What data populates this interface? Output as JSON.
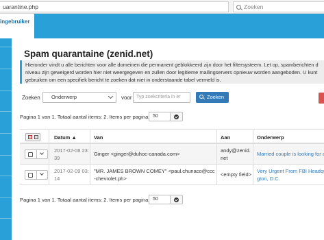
{
  "browser": {
    "url": "uarantine.php",
    "search_placeholder": "Zoeken"
  },
  "header": {
    "user_label": "ingebruiker"
  },
  "page": {
    "title": "Spam quarantaine (zenid.net)",
    "info_lines": [
      "Hieronder vindt u alle berichten voor alle domeinen die permanent geblokkeerd zijn door het filtersysteem. Let op, spamberichten d",
      "niveau zijn geweigerd worden hier niet weergegeven en zullen door legitieme mailingservers opnieuw worden aangeboden. U kunt",
      "gebruiken om een specifiek bericht te zoeken dat niet in onderstaande tabel vermeld is."
    ]
  },
  "filter": {
    "search_label": "Zoeken",
    "field_value": "Onderwerp",
    "voor_label": "voor",
    "criteria_placeholder": "Typ zoekcriteria in er",
    "search_button": "Zoeken"
  },
  "pager_top": {
    "text": "Pagina 1 van 1. Totaal aantal items: 2. Items per pagina:",
    "per_page": "50"
  },
  "pager_bottom": {
    "text": "Pagina 1 van 1. Totaal aantal items: 2. Items per pagina:",
    "per_page": "50"
  },
  "table": {
    "columns": [
      "Datum ▲",
      "Van",
      "Aan",
      "Onderwerp"
    ],
    "rows": [
      {
        "date_l1": "2017-02-08 23:",
        "date_l2": "39",
        "from_l1": "Ginger <ginger@duhoc-canada.com>",
        "from_l2": "",
        "to_l1": "andy@zenid.",
        "to_l2": "net",
        "subject_l1": "Married couple is looking for a",
        "subject_l2": ""
      },
      {
        "date_l1": "2017-02-09 03:",
        "date_l2": "14",
        "from_l1": "\"MR. JAMES BROWN COMEY\" <paul.chunaco@ccc",
        "from_l2": "-chevrolet.ph>",
        "to_l1": "<empty field>",
        "to_l2": "",
        "subject_l1": "Very Urgent From FBI Headqu",
        "subject_l2": "gton, D.C."
      }
    ]
  }
}
